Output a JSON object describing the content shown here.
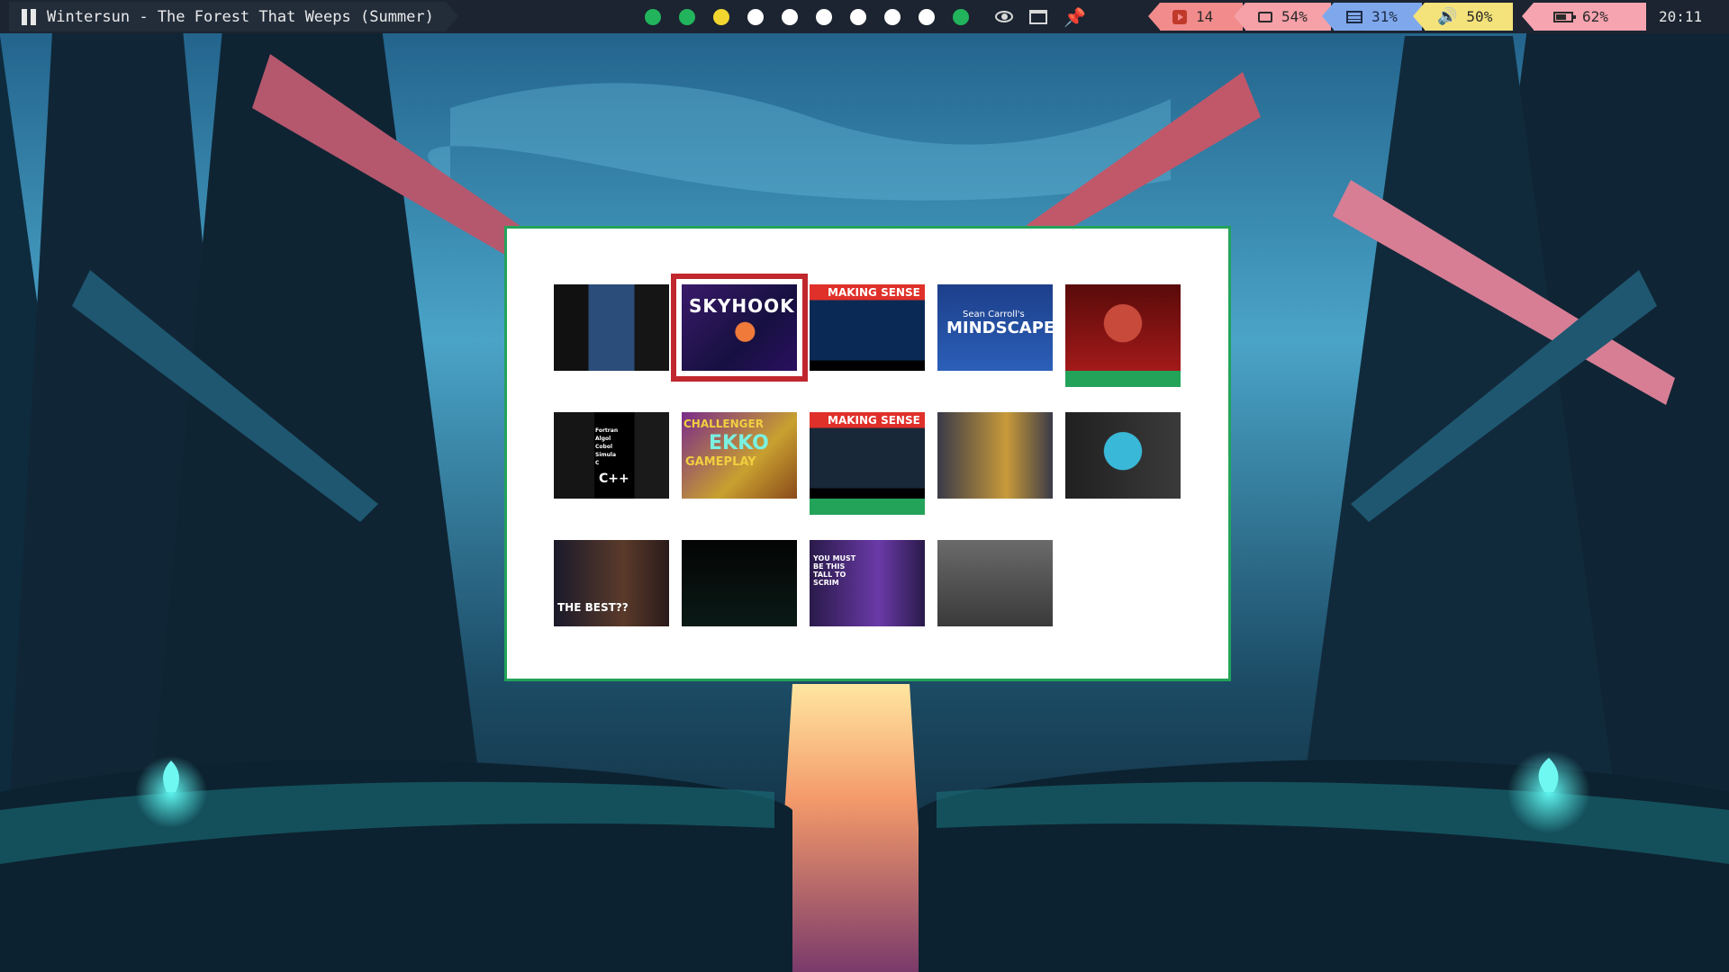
{
  "topbar": {
    "now_playing": "Wintersun - The Forest That Weeps (Summer)",
    "workspaces": [
      {
        "color": "#22b45c"
      },
      {
        "color": "#22b45c"
      },
      {
        "color": "#f2d630"
      },
      {
        "color": "#ffffff"
      },
      {
        "color": "#ffffff"
      },
      {
        "color": "#ffffff"
      },
      {
        "color": "#ffffff"
      },
      {
        "color": "#ffffff"
      },
      {
        "color": "#ffffff"
      },
      {
        "color": "#22b45c"
      }
    ],
    "tray_icons": [
      "eye-icon",
      "window-icon",
      "pin-icon"
    ],
    "status": {
      "youtube_count": "14",
      "disk": "54%",
      "memory": "31%",
      "volume": "50%",
      "battery": "62%",
      "clock": "20:11"
    }
  },
  "launcher": {
    "border_color": "#23a35a",
    "selected_index": 1,
    "thumbnails": [
      {
        "name": "thumb-podcast-brain",
        "text": "",
        "watched": false
      },
      {
        "name": "thumb-skyhook",
        "text": "SKYHOOK",
        "watched": false
      },
      {
        "name": "thumb-making-sense-1",
        "text": "MAKING SENSE",
        "watched": false
      },
      {
        "name": "thumb-mindscape",
        "text": "MINDSCAPE",
        "subtext": "Sean Carroll's",
        "watched": false
      },
      {
        "name": "thumb-superhero",
        "text": "",
        "watched": true
      },
      {
        "name": "thumb-programming-languages",
        "text": "C++",
        "subtext": "Fortran Algol Cobol Simula C",
        "watched": false
      },
      {
        "name": "thumb-ekko-gameplay",
        "text": "EKKO",
        "subtext": "CHALLENGER",
        "extra": "GAMEPLAY",
        "watched": false
      },
      {
        "name": "thumb-making-sense-2",
        "text": "MAKING SENSE",
        "watched": true
      },
      {
        "name": "thumb-art",
        "text": "",
        "watched": false
      },
      {
        "name": "thumb-compass",
        "text": "",
        "watched": false
      },
      {
        "name": "thumb-the-best",
        "text": "THE BEST??",
        "watched": false
      },
      {
        "name": "thumb-waveform",
        "text": "",
        "watched": false
      },
      {
        "name": "thumb-scrim",
        "text": "YOU MUST BE THIS TALL TO SCRIM",
        "watched": false
      },
      {
        "name": "thumb-snake",
        "text": "",
        "watched": false
      }
    ]
  }
}
